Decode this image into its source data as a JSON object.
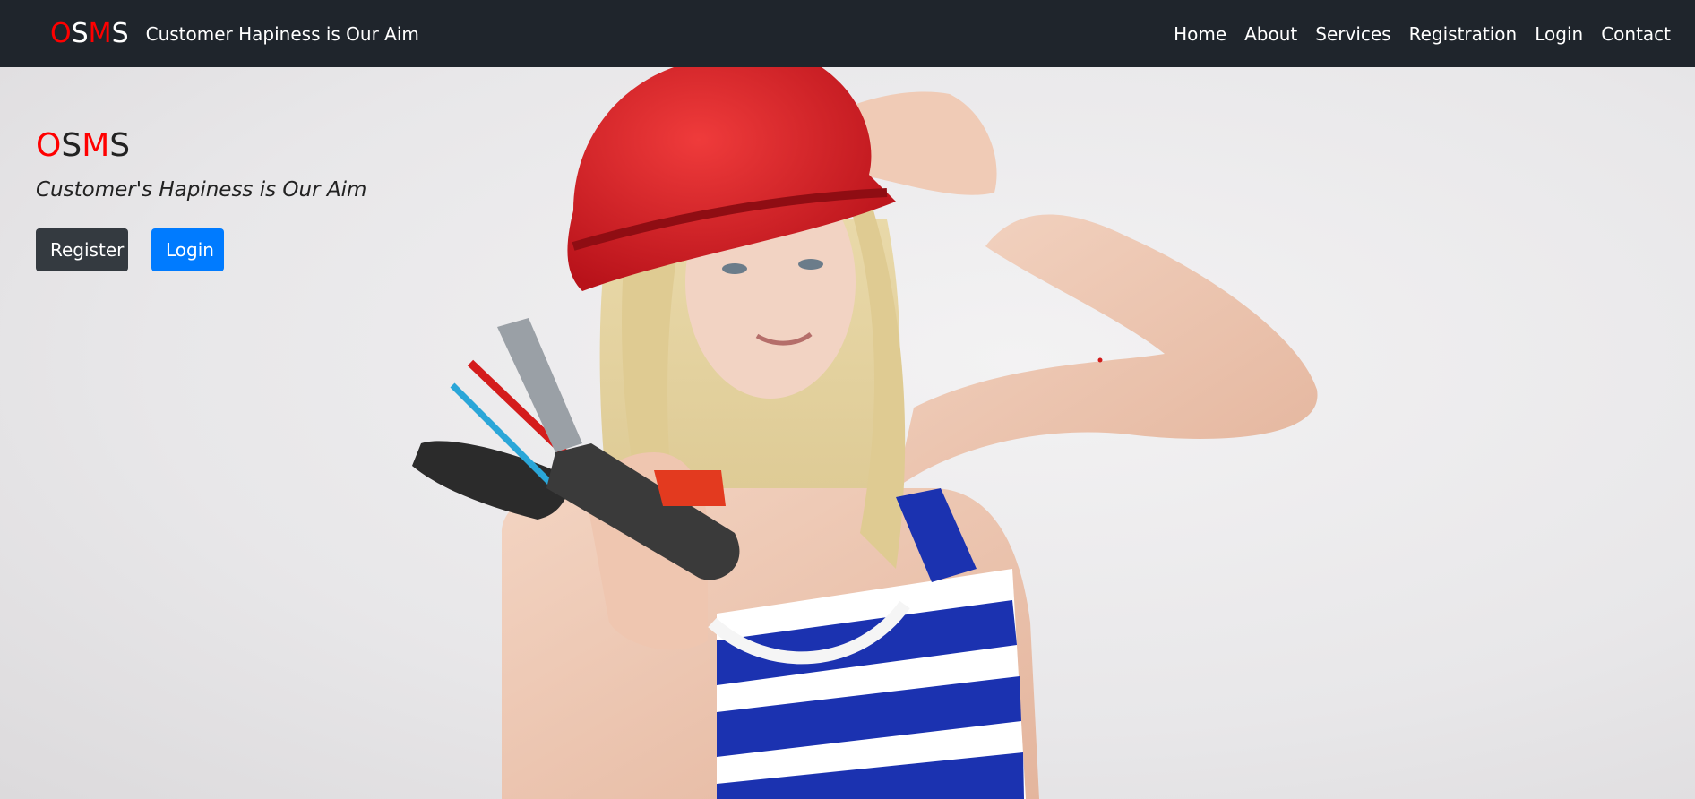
{
  "navbar": {
    "brand_letters": [
      "O",
      "S",
      "M",
      "S"
    ],
    "tagline": "Customer Hapiness is Our Aim",
    "links": [
      "Home",
      "About",
      "Services",
      "Registration",
      "Login",
      "Contact"
    ]
  },
  "hero": {
    "title_letters": [
      "O",
      "S",
      "M",
      "S"
    ],
    "subtitle": "Customer's Hapiness is Our Aim",
    "register_label": "Register",
    "login_label": "Login"
  },
  "colors": {
    "navbar_bg": "#1f252c",
    "brand_red": "#ff0000",
    "btn_dark": "#343a40",
    "btn_primary": "#007bff"
  }
}
